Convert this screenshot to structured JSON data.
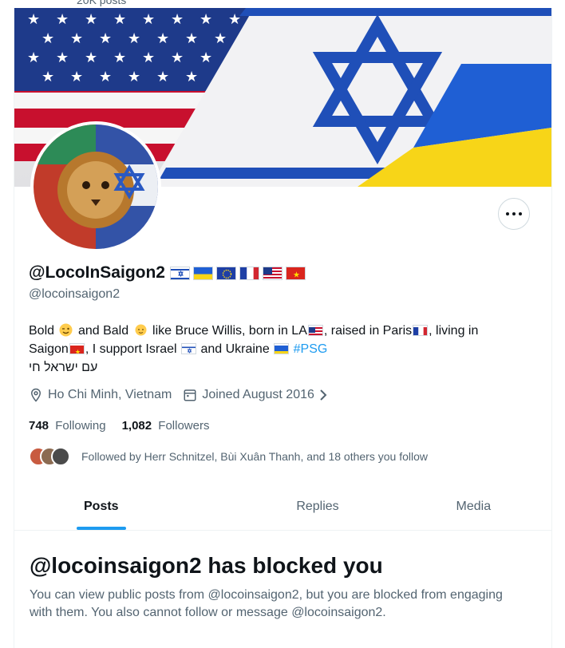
{
  "top_cut_text": "20K posts",
  "profile": {
    "display_name": "@LocoInSaigon2",
    "handle": "@locoinsaigon2",
    "bio": {
      "line1_a": "Bold",
      "line1_b": "and Bald",
      "line1_c": "like Bruce Willis, born in LA",
      "line1_d": ", raised in Paris",
      "line1_e": ", living in",
      "line2_a": "Saigon",
      "line2_b": ", I support Israel",
      "line2_c": "and Ukraine",
      "hashtag": "#PSG",
      "line3": "עם ישראל חי"
    },
    "location": "Ho Chi Minh, Vietnam",
    "joined": "Joined August 2016",
    "following_count": "748",
    "following_label": "Following",
    "followers_count": "1,082",
    "followers_label": "Followers",
    "followed_by": "Followed by Herr Schnitzel, Bùi Xuân Thanh, and 18 others you follow"
  },
  "icons": {
    "more": "more-horizontal-icon",
    "location": "location-pin-icon",
    "calendar": "calendar-icon",
    "chevron": "chevron-right-icon"
  },
  "tabs": [
    {
      "label": "Posts",
      "active": true
    },
    {
      "label": "Replies",
      "active": false
    },
    {
      "label": "Media",
      "active": false
    }
  ],
  "blocked": {
    "title": "@locoinsaigon2 has blocked you",
    "message": "You can view public posts from @locoinsaigon2, but you are blocked from engaging with them. You also cannot follow or message @locoinsaigon2."
  },
  "colors": {
    "accent": "#1d9bf0",
    "secondary_text": "#536471",
    "border": "#eff3f4"
  }
}
